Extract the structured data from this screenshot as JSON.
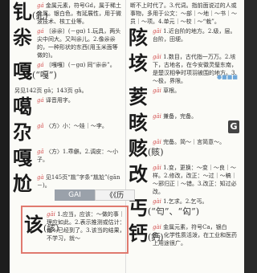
{
  "left_col": [
    {
      "hw": "钆",
      "trad": "(釓)",
      "pin": "gá",
      "text": "金属元素，符号Gd，属于稀土金属。银白色，有延展性，用于微波技术、核工业等。"
    },
    {
      "hw": "尜",
      "trad": "",
      "pin": "gá",
      "text": "〔尜尜〕(－gɑ) 1.玩具，两头尖中间大。又叫尜儿。2.像尜尜的，一种形状的东西(用玉米面等做的)。"
    },
    {
      "hw": "嘎",
      "trad": "(“嘎”)",
      "pin": "gá",
      "text": "〔嘎嘎〕(－gɑ) 同“尜尜”。"
    },
    {
      "hw": "",
      "trad": "",
      "pin": "",
      "text": "另见142页 gā；143页 gǎ。"
    },
    {
      "hw": "噶",
      "trad": "",
      "pin": "gá",
      "text": "译音用字。"
    },
    {
      "hw": "尕",
      "trad": "",
      "pin": "gǎ",
      "text": "〈方〉小：～娃｜～李。"
    },
    {
      "hw": "嘎",
      "trad": "",
      "pin": "gǎ",
      "text": "〈方〉1.乖僻。2.调皮：～小子。"
    },
    {
      "hw": "尬",
      "trad": "",
      "pin": "gà",
      "text": "见145页“尴”字条“尴尬”(gān－)。"
    }
  ],
  "right_col": [
    {
      "hw": "",
      "trad": "",
      "pin": "",
      "text": "断不上时代了。3.代词。指前面说过的人或事物，多用于公文：～部｜～地｜～书｜～员｜～项。4.单元｜～校｜～“栽”。"
    },
    {
      "hw": "陔",
      "trad": "",
      "pin": "gāi",
      "text": "1.近台阶的地方。2.级，层。台阶，田埂。"
    },
    {
      "hw": "垓",
      "trad": "",
      "pin": "gāi",
      "text": "1.数目，古代指一万万。2.垓下，古地名，在今安徽灵璧东南，是楚汉相争时项羽被围的地方。3.～极，界限。"
    },
    {
      "hw": "荄",
      "trad": "",
      "pin": "gāi",
      "text": "草根。"
    },
    {
      "hw": "晐",
      "trad": "",
      "pin": "gāi",
      "text": "兼备，完备。"
    },
    {
      "hw": "赅",
      "trad": "(賅)",
      "pin": "gāi",
      "text": "完备。简～｜言简意～。"
    },
    {
      "hw": "改",
      "trad": "",
      "pin": "gǎi",
      "text": "1.变，更换：～变｜～良｜～样。2.修改，改正：～过｜～稿｜～邪归正｜～错。3.改正：知过必改。"
    },
    {
      "hw": "丐",
      "trad": "(“匄”、“匃”)",
      "pin": "gài",
      "text": "1.乞求。2.乞丐。"
    },
    {
      "hw": "钙",
      "trad": "(鈣)",
      "pin": "gài",
      "text": "金属元素，符号Ca，银白色，化学性质活泼，在工业和医药上用途很广。"
    }
  ],
  "tabs": {
    "gai": "GAI",
    "kk": "《《历"
  },
  "highlight": {
    "hw": "该",
    "trad": "(該)",
    "pin": "gāi",
    "text": "1.应当，应该：～做的事｜理应如此。2.表示推测或估计：他～已经到了。3.该当的结果，不学习，就～"
  },
  "side_badge": "G",
  "blue_badge": "●■■■"
}
